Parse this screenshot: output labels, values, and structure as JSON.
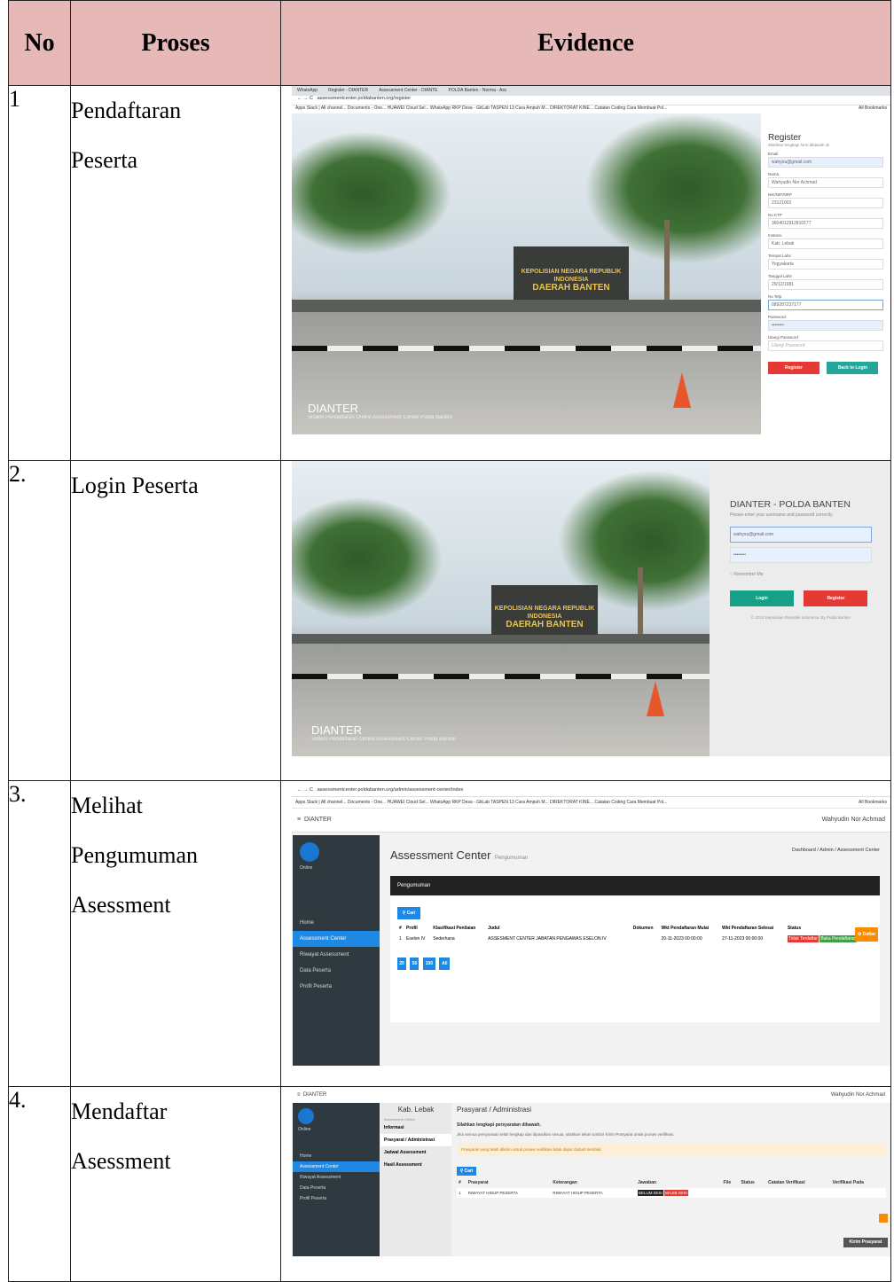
{
  "headers": {
    "no": "No",
    "proses": "Proses",
    "evidence": "Evidence"
  },
  "rows": [
    {
      "no": "1",
      "proses": [
        "Pendaftaran",
        "Peserta"
      ]
    },
    {
      "no": "2.",
      "proses": [
        "Login Peserta"
      ]
    },
    {
      "no": "3.",
      "proses": [
        "Melihat",
        "Pengumuman",
        "Asessment"
      ]
    },
    {
      "no": "4.",
      "proses": [
        "Mendaftar",
        "Asessment"
      ]
    }
  ],
  "shot1": {
    "tabs": [
      "WhatsApp",
      "Register - DIANTER",
      "Assessment Center - DIANTE",
      "POLDA Banten - Norma - Asc"
    ],
    "url": "assessmentcenter.poldabanten.org/register",
    "bookmarks": "Apps   Slack | All channel...   Documents - One...   HUAWEI Cloud Sel...   WhatsApp   RKP Desa - GitLab   TASPEN   13 Cara Ampuh M...   DIREKTORAT KINE...   Catatan Coding   Cara Membuat Pol...",
    "all_bookmarks": "All Bookmarks",
    "sign_title": "KEPOLISIAN NEGARA REPUBLIK INDONESIA",
    "sign_sub": "DAERAH BANTEN",
    "wm_title": "DIANTER",
    "wm_sub": "Sistem Pendaftaran Online Assessment Center Polda Banten",
    "form_title": "Register",
    "form_sub": "Silahkan lengkapi form dibawah ini",
    "fields": [
      {
        "label": "Email",
        "value": "wahyou@gmail.com"
      },
      {
        "label": "Nama",
        "value": "Wahyudin Nor Achmad"
      },
      {
        "label": "NIK/NIP/NRP",
        "value": "23121002"
      },
      {
        "label": "No KTP",
        "value": "3604012912810177"
      },
      {
        "label": "Instansi",
        "value": "Kab. Lebak"
      },
      {
        "label": "Tempat Lahir",
        "value": "Yogyakarta"
      },
      {
        "label": "Tanggal Lahir",
        "value": "29/12/1981"
      },
      {
        "label": "No Telp",
        "value": "089287237177"
      },
      {
        "label": "Password",
        "value": "••••••••"
      },
      {
        "label": "Ulangi Password",
        "value": "Ulangi Password"
      }
    ],
    "btn_register": "Register",
    "btn_back": "Back to Login"
  },
  "shot2": {
    "sign_title": "KEPOLISIAN NEGARA REPUBLIK INDONESIA",
    "sign_sub": "DAERAH BANTEN",
    "wm_title": "DIANTER",
    "wm_sub": "Sistem Pendaftaran Online Assessment Center Polda Banten",
    "title": "DIANTER - POLDA BANTEN",
    "sub": "Please enter your username and password correctly",
    "email": "wahyou@gmail.com",
    "password": "••••••••",
    "remember": "Remember Me",
    "login": "Login",
    "register": "Register",
    "copyright": "© 2023 Kepolisian Republik Indonesia. By Polda Banten"
  },
  "shot3": {
    "url": "assessmentcenter.poldabanten.org/admin/assessment-center/index",
    "bookmarks": "Apps   Slack | All channel...   Documents - One...   HUAWEI Cloud Sel...   WhatsApp   RKP Desa - GitLab   TASPEN   13 Cara Ampuh M...   DIREKTORAT KINE...   Catatan Coding   Cara Membuat Pol...",
    "all_bookmarks": "All Bookmarks",
    "brand": "DIANTER",
    "user": "Wahyudin Nor Achmad",
    "online": "Online",
    "menu": [
      "Home",
      "Assessment Center",
      "Riwayat Assessment",
      "Data Peserta",
      "Profil Peserta"
    ],
    "page_title": "Assessment Center",
    "page_sub": "Pengumuman",
    "crumbs": [
      "Dashboard",
      "Admin",
      "Assessment Center"
    ],
    "panel": "Pengumuman",
    "search": "Cari",
    "cols": [
      "#",
      "Profil",
      "Klasifikasi Penilaian",
      "Judul",
      "Dokumen",
      "Wkt Pendaftaran Mulai",
      "Wkt Pendaftaran Selesai",
      "Status"
    ],
    "row": [
      "1",
      "Eselon IV",
      "Sederhana",
      "ASSESMENT CENTER JABATAN PENGAWAS ESELON IV",
      "",
      "20-11-2023 00:00:00",
      "27-11-2023 00:00:00"
    ],
    "status1": "Tidak Terdaftar",
    "status2": "Buka Pendaftaran",
    "daftar": "Daftar",
    "pages": [
      "20",
      "50",
      "100",
      "All"
    ]
  },
  "shot4": {
    "brand": "DIANTER",
    "user": "Wahyudin Nor Achmad",
    "online": "Online",
    "menu": [
      "Home",
      "Assessment Center",
      "Riwayat Assessment",
      "Data Peserta",
      "Profil Peserta"
    ],
    "instansi": "Kab. Lebak",
    "sub_small": "Assessment Center",
    "submenu": [
      "Informasi",
      "Prasyarat / Administrasi",
      "Jadwal Assessment",
      "Hasil Assessment"
    ],
    "title": "Prasyarat / Administrasi",
    "l1": "Silahkan lengkapi persyaratan dibawah.",
    "l2": "Jika semua persyaratan telah lengkap dan dipastikan sesuai, silahkan tekan tombol Kirim Prasyarat untuk proses verifikasi.",
    "alert": "Prasyaran yang telah dikirim untuk proses verifikasi tidak dapat diubah kembali.",
    "search": "Cari",
    "cols": [
      "#",
      "Prasyarat",
      "Keterangan",
      "Jawaban",
      "File",
      "Status",
      "Catatan Verifikasi",
      "Verifikasi Pada"
    ],
    "row": [
      "1",
      "RIWAYAT HIDUP PESERTA",
      "RIWAYAT HIDUP PESERTA"
    ],
    "tag1": "BELUM DIISI",
    "tag2": "WAJIB DIISI",
    "kirim": "Kirim Prasyarat"
  }
}
